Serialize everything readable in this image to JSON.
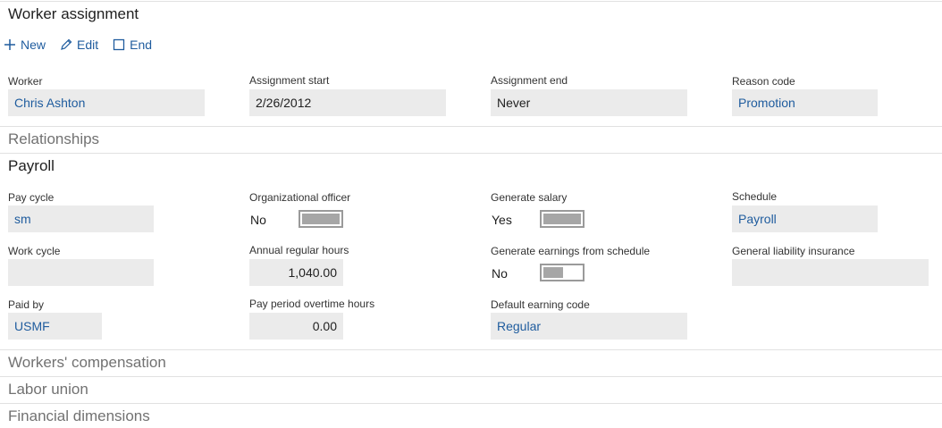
{
  "header": {
    "title": "Worker assignment"
  },
  "toolbar": {
    "new_label": "New",
    "edit_label": "Edit",
    "end_label": "End"
  },
  "assignment": {
    "worker_label": "Worker",
    "worker_value": "Chris Ashton",
    "start_label": "Assignment start",
    "start_value": "2/26/2012",
    "end_label": "Assignment end",
    "end_value": "Never",
    "reason_label": "Reason code",
    "reason_value": "Promotion"
  },
  "sections": {
    "relationships": "Relationships",
    "payroll": "Payroll",
    "workers_comp": "Workers' compensation",
    "labor_union": "Labor union",
    "financial_dimensions": "Financial dimensions"
  },
  "payroll": {
    "pay_cycle_label": "Pay cycle",
    "pay_cycle_value": "sm",
    "org_officer_label": "Organizational officer",
    "org_officer_value": "No",
    "gen_salary_label": "Generate salary",
    "gen_salary_value": "Yes",
    "schedule_label": "Schedule",
    "schedule_value": "Payroll",
    "work_cycle_label": "Work cycle",
    "work_cycle_value": "",
    "annual_hours_label": "Annual regular hours",
    "annual_hours_value": "1,040.00",
    "gen_earnings_label": "Generate earnings from schedule",
    "gen_earnings_value": "No",
    "gl_insurance_label": "General liability insurance",
    "gl_insurance_value": "",
    "paid_by_label": "Paid by",
    "paid_by_value": "USMF",
    "overtime_label": "Pay period overtime hours",
    "overtime_value": "0.00",
    "earning_code_label": "Default earning code",
    "earning_code_value": "Regular"
  },
  "colors": {
    "accent": "#1f5c9e",
    "field_bg": "#ebebeb",
    "divider": "#e1e1e1"
  }
}
